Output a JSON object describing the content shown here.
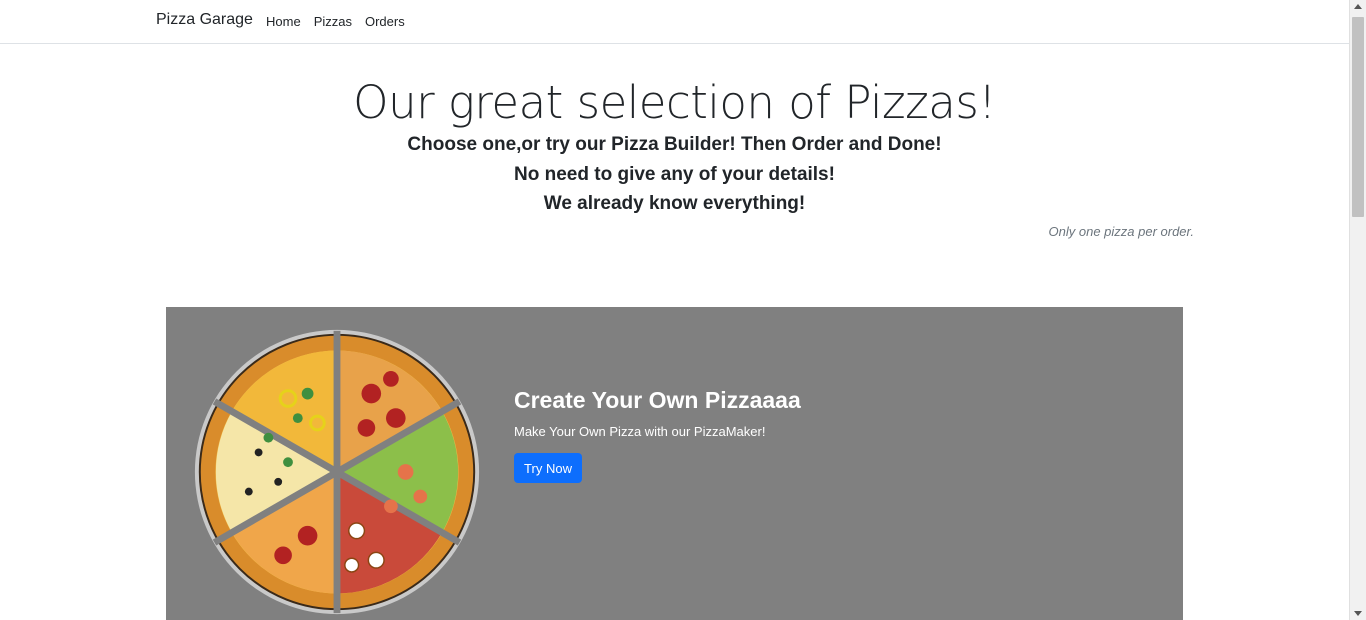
{
  "navbar": {
    "brand": "Pizza Garage",
    "links": [
      "Home",
      "Pizzas",
      "Orders"
    ]
  },
  "hero": {
    "title": "Our great selection of Pizzas!",
    "lines": [
      "Choose one,or try our Pizza Builder! Then Order and Done!",
      "No need to give any of your details!",
      "We already know everything!"
    ],
    "note": "Only one pizza per order."
  },
  "card": {
    "title": "Create Your Own Pizzaaaa",
    "text": "Make Your Own Pizza with our PizzaMaker!",
    "button": "Try Now",
    "background": "#808080",
    "button_color": "#0d6efd",
    "image": "pizza-illustration"
  }
}
